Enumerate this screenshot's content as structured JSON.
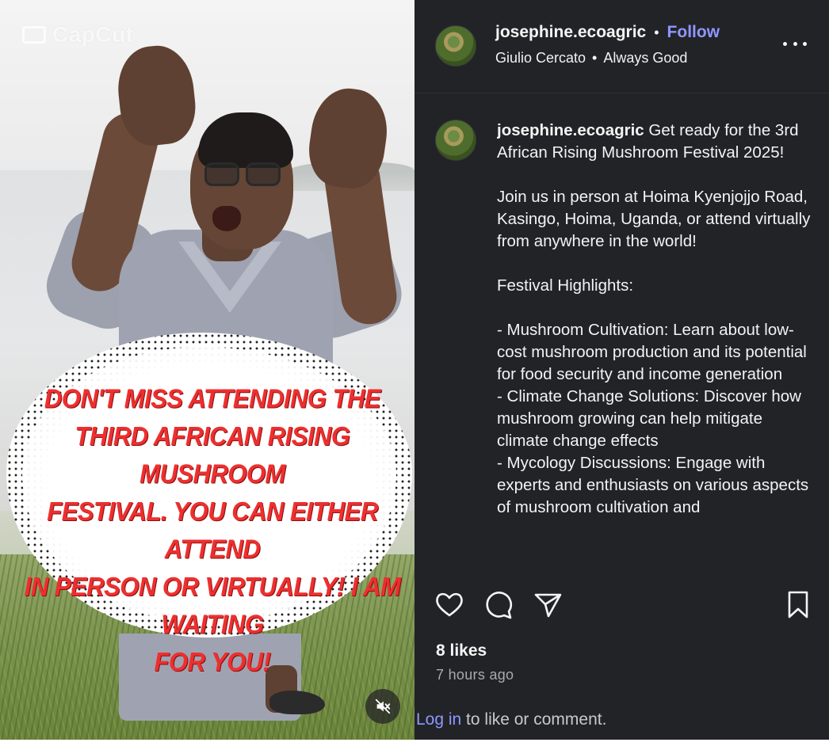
{
  "video": {
    "watermark": "CapCut",
    "bubble_lines": [
      "Don't miss attending the",
      "third African Rising mushroom",
      "festival. You can either attend",
      "in person or virtually! I am",
      "waiting",
      "for you!"
    ],
    "mute_icon": "speaker-muted-icon"
  },
  "post": {
    "username": "josephine.ecoagric",
    "separator": "•",
    "follow_label": "Follow",
    "audio_artist": "Giulio Cercato",
    "audio_title": "Always Good",
    "caption_username": "josephine.ecoagric",
    "caption_text": " Get ready for the 3rd African Rising Mushroom Festival 2025!\n\nJoin us in person at Hoima Kyenjojjo Road, Kasingo, Hoima, Uganda, or attend virtually from anywhere in the world!\n\nFestival Highlights:\n\n- Mushroom Cultivation: Learn about low-cost mushroom production and its potential for food security and income generation\n- Climate Change Solutions: Discover how mushroom growing can help mitigate climate change effects\n- Mycology Discussions: Engage with experts and enthusiasts on various aspects of mushroom cultivation and",
    "likes": "8 likes",
    "time_ago": "7 hours ago",
    "login_link": "Log in",
    "login_suffix": " to like or comment."
  },
  "colors": {
    "panel_bg": "#222327",
    "accent": "#8f97ff",
    "bubble_text": "#ee2f2f"
  }
}
